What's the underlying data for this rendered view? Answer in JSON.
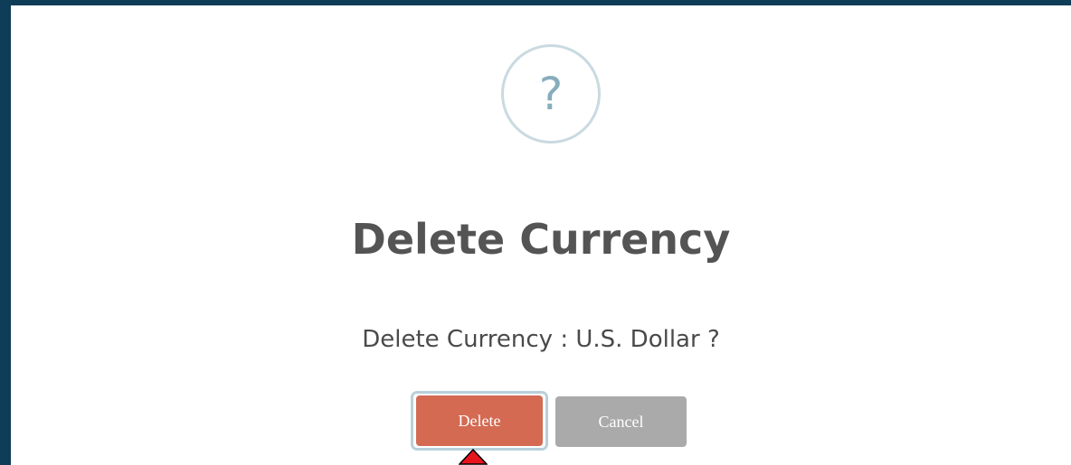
{
  "dialog": {
    "icon": "question-circle-icon",
    "icon_glyph": "?",
    "title": "Delete Currency",
    "message": "Delete Currency : U.S. Dollar ?",
    "buttons": {
      "delete_label": "Delete",
      "cancel_label": "Cancel"
    }
  },
  "colors": {
    "backdrop": "#0f3d57",
    "dialog_bg": "#ffffff",
    "delete_button": "#d46a52",
    "cancel_button": "#aaaaaa",
    "icon_ring": "#c9dae1",
    "icon_glyph": "#87adbd",
    "cursor": "#e8141d"
  },
  "cursor": {
    "icon": "arrow-cursor-icon"
  }
}
